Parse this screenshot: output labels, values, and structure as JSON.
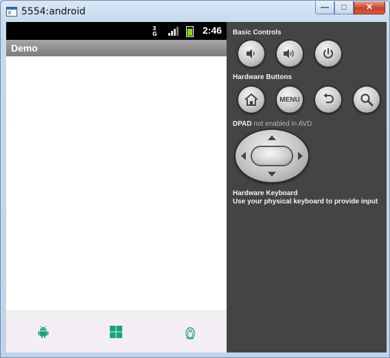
{
  "window": {
    "title": "5554:android"
  },
  "statusbar": {
    "network": "3G",
    "time": "2:46"
  },
  "app": {
    "title": "Demo"
  },
  "bottom_nav": [
    {
      "icon": "android-icon"
    },
    {
      "icon": "windows-icon"
    },
    {
      "icon": "penguin-icon"
    }
  ],
  "controls": {
    "basic_label": "Basic Controls",
    "hardware_label": "Hardware Buttons",
    "menu_label": "MENU",
    "dpad_label": "DPAD",
    "dpad_note": "not enabled in AVD",
    "keyboard_label": "Hardware Keyboard",
    "keyboard_note": "Use your physical keyboard to provide input"
  },
  "colors": {
    "accent_green": "#1aa37a",
    "panel_bg": "#444444",
    "action_bar": "#8c8c8c"
  }
}
